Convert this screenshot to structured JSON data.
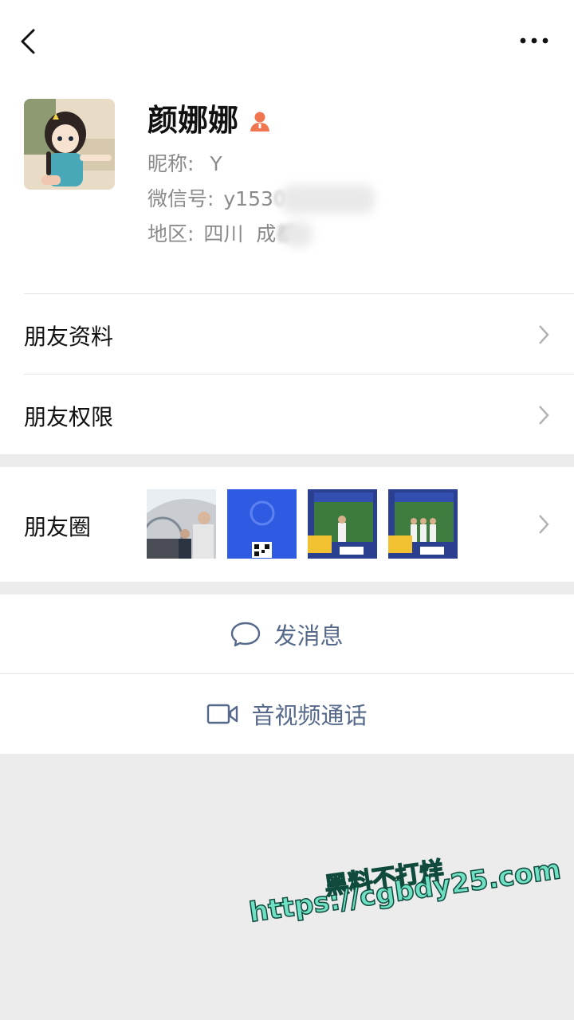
{
  "header": {
    "back_icon": "chevron-left-icon",
    "more_icon": "more-dots-icon"
  },
  "profile": {
    "name": "颜娜娜",
    "nickname_label": "昵称:",
    "nickname": "Y",
    "wechat_id_label": "微信号:",
    "wechat_id": "y153",
    "wechat_id_blur_char": "0",
    "region_label": "地区:",
    "region": "四川  成",
    "region_blur_char": "都"
  },
  "menu": {
    "friend_info": "朋友资料",
    "friend_permissions": "朋友权限",
    "moments": "朋友圈"
  },
  "actions": {
    "message": "发消息",
    "video_call": "音视频通话"
  },
  "watermark": {
    "line1": "黑料不打烊",
    "line2": "https://cgbdy25.com"
  },
  "colors": {
    "accent": "#56698a",
    "badge": "#f07652",
    "watermark_fill": "#6fe0c3"
  }
}
